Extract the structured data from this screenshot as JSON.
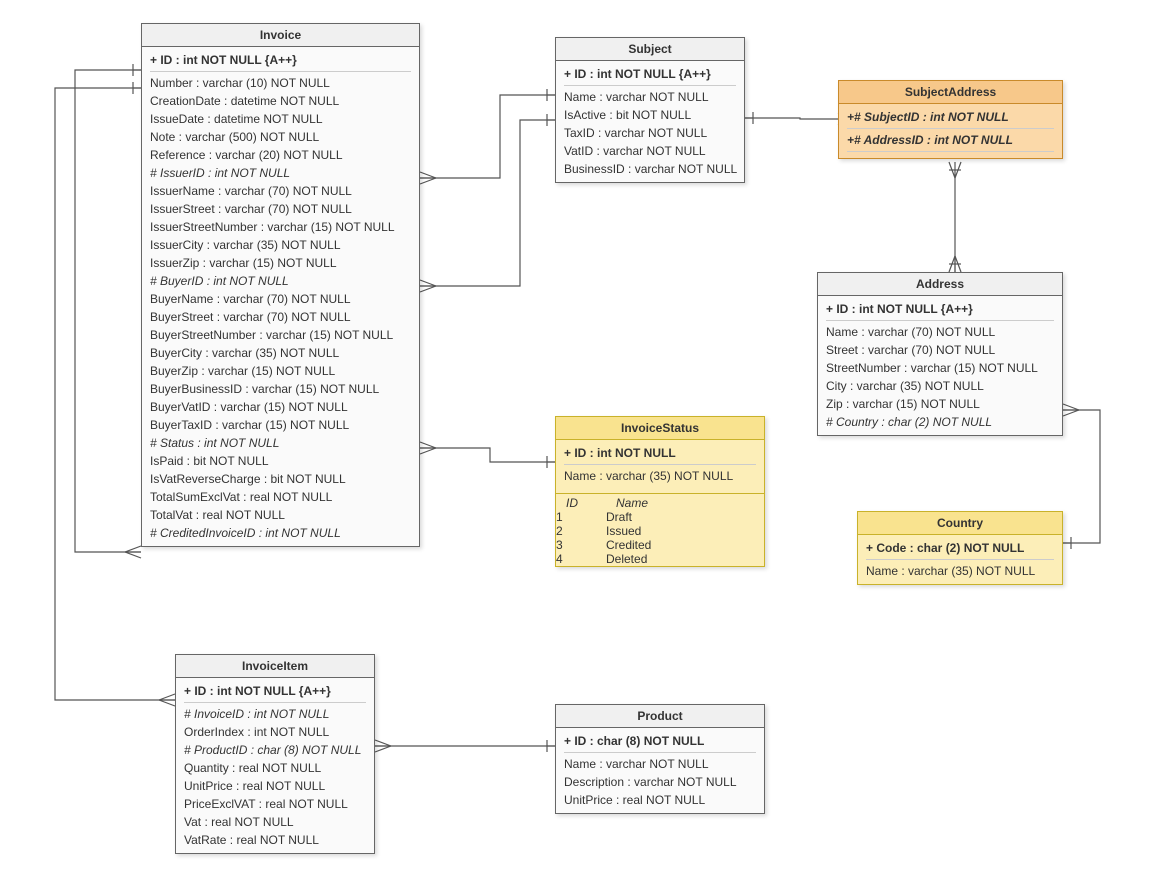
{
  "entities": {
    "invoice": {
      "title": "Invoice",
      "attrs": [
        {
          "text": "+ ID : int NOT NULL  {A++}",
          "pk": true
        },
        {
          "text": "Number : varchar (10)  NOT NULL"
        },
        {
          "text": "CreationDate : datetime NOT NULL"
        },
        {
          "text": "IssueDate : datetime NOT NULL"
        },
        {
          "text": "Note : varchar (500)  NOT NULL"
        },
        {
          "text": "Reference : varchar (20)  NOT NULL"
        },
        {
          "text": "# IssuerID : int NOT NULL",
          "fk": true
        },
        {
          "text": "IssuerName : varchar (70)  NOT NULL"
        },
        {
          "text": "IssuerStreet : varchar (70)  NOT NULL"
        },
        {
          "text": "IssuerStreetNumber : varchar (15)  NOT NULL"
        },
        {
          "text": "IssuerCity : varchar (35)  NOT NULL"
        },
        {
          "text": "IssuerZip : varchar (15)  NOT NULL"
        },
        {
          "text": "# BuyerID : int NOT NULL",
          "fk": true
        },
        {
          "text": "BuyerName : varchar (70)  NOT NULL"
        },
        {
          "text": "BuyerStreet : varchar (70)  NOT NULL"
        },
        {
          "text": "BuyerStreetNumber : varchar (15)  NOT NULL"
        },
        {
          "text": "BuyerCity : varchar (35)  NOT NULL"
        },
        {
          "text": "BuyerZip : varchar (15)  NOT NULL"
        },
        {
          "text": "BuyerBusinessID : varchar (15)  NOT NULL"
        },
        {
          "text": "BuyerVatID : varchar (15)  NOT NULL"
        },
        {
          "text": "BuyerTaxID : varchar (15)  NOT NULL"
        },
        {
          "text": "# Status : int NOT NULL",
          "fk": true
        },
        {
          "text": "IsPaid : bit NOT NULL"
        },
        {
          "text": "IsVatReverseCharge : bit NOT NULL"
        },
        {
          "text": "TotalSumExclVat : real NOT NULL"
        },
        {
          "text": "TotalVat : real NOT NULL"
        },
        {
          "text": "# CreditedInvoiceID : int NOT NULL",
          "fk": true
        }
      ]
    },
    "subject": {
      "title": "Subject",
      "attrs": [
        {
          "text": "+ ID : int NOT NULL  {A++}",
          "pk": true
        },
        {
          "text": "Name : varchar NOT NULL"
        },
        {
          "text": "IsActive : bit NOT NULL"
        },
        {
          "text": "TaxID : varchar NOT NULL"
        },
        {
          "text": "VatID : varchar NOT NULL"
        },
        {
          "text": "BusinessID : varchar NOT NULL"
        }
      ]
    },
    "subjectAddress": {
      "title": "SubjectAddress",
      "attrs": [
        {
          "text": "+# SubjectID : int NOT NULL",
          "pk": true,
          "fk": true
        },
        {
          "text": "+# AddressID : int NOT NULL",
          "pk": true,
          "fk": true
        }
      ]
    },
    "address": {
      "title": "Address",
      "attrs": [
        {
          "text": "+ ID : int NOT NULL  {A++}",
          "pk": true
        },
        {
          "text": "Name : varchar (70)  NOT NULL"
        },
        {
          "text": "Street : varchar (70)  NOT NULL"
        },
        {
          "text": "StreetNumber : varchar (15)  NOT NULL"
        },
        {
          "text": "City : varchar (35)  NOT NULL"
        },
        {
          "text": "Zip : varchar (15)  NOT NULL"
        },
        {
          "text": "# Country : char (2)  NOT NULL",
          "fk": true
        }
      ]
    },
    "invoiceStatus": {
      "title": "InvoiceStatus",
      "attrs": [
        {
          "text": "+ ID : int NOT NULL",
          "pk": true
        },
        {
          "text": "Name : varchar (35)  NOT NULL"
        }
      ],
      "enumHeader": {
        "id": "ID",
        "name": "Name"
      },
      "enumRows": [
        {
          "id": "1",
          "name": "Draft"
        },
        {
          "id": "2",
          "name": "Issued"
        },
        {
          "id": "3",
          "name": "Credited"
        },
        {
          "id": "4",
          "name": "Deleted"
        }
      ]
    },
    "country": {
      "title": "Country",
      "attrs": [
        {
          "text": "+ Code : char (2)  NOT NULL",
          "pk": true
        },
        {
          "text": "Name : varchar (35)  NOT NULL"
        }
      ]
    },
    "invoiceItem": {
      "title": "InvoiceItem",
      "attrs": [
        {
          "text": "+ ID : int NOT NULL  {A++}",
          "pk": true
        },
        {
          "text": "# InvoiceID : int NOT NULL",
          "fk": true
        },
        {
          "text": "OrderIndex : int NOT NULL"
        },
        {
          "text": "# ProductID : char (8)  NOT NULL",
          "fk": true
        },
        {
          "text": "Quantity : real NOT NULL"
        },
        {
          "text": "UnitPrice : real NOT NULL"
        },
        {
          "text": "PriceExclVAT : real NOT NULL"
        },
        {
          "text": "Vat : real NOT NULL"
        },
        {
          "text": "VatRate : real NOT NULL"
        }
      ]
    },
    "product": {
      "title": "Product",
      "attrs": [
        {
          "text": "+ ID : char (8)  NOT NULL",
          "pk": true
        },
        {
          "text": "Name : varchar NOT NULL"
        },
        {
          "text": "Description : varchar NOT NULL"
        },
        {
          "text": "UnitPrice : real NOT NULL"
        }
      ]
    }
  }
}
